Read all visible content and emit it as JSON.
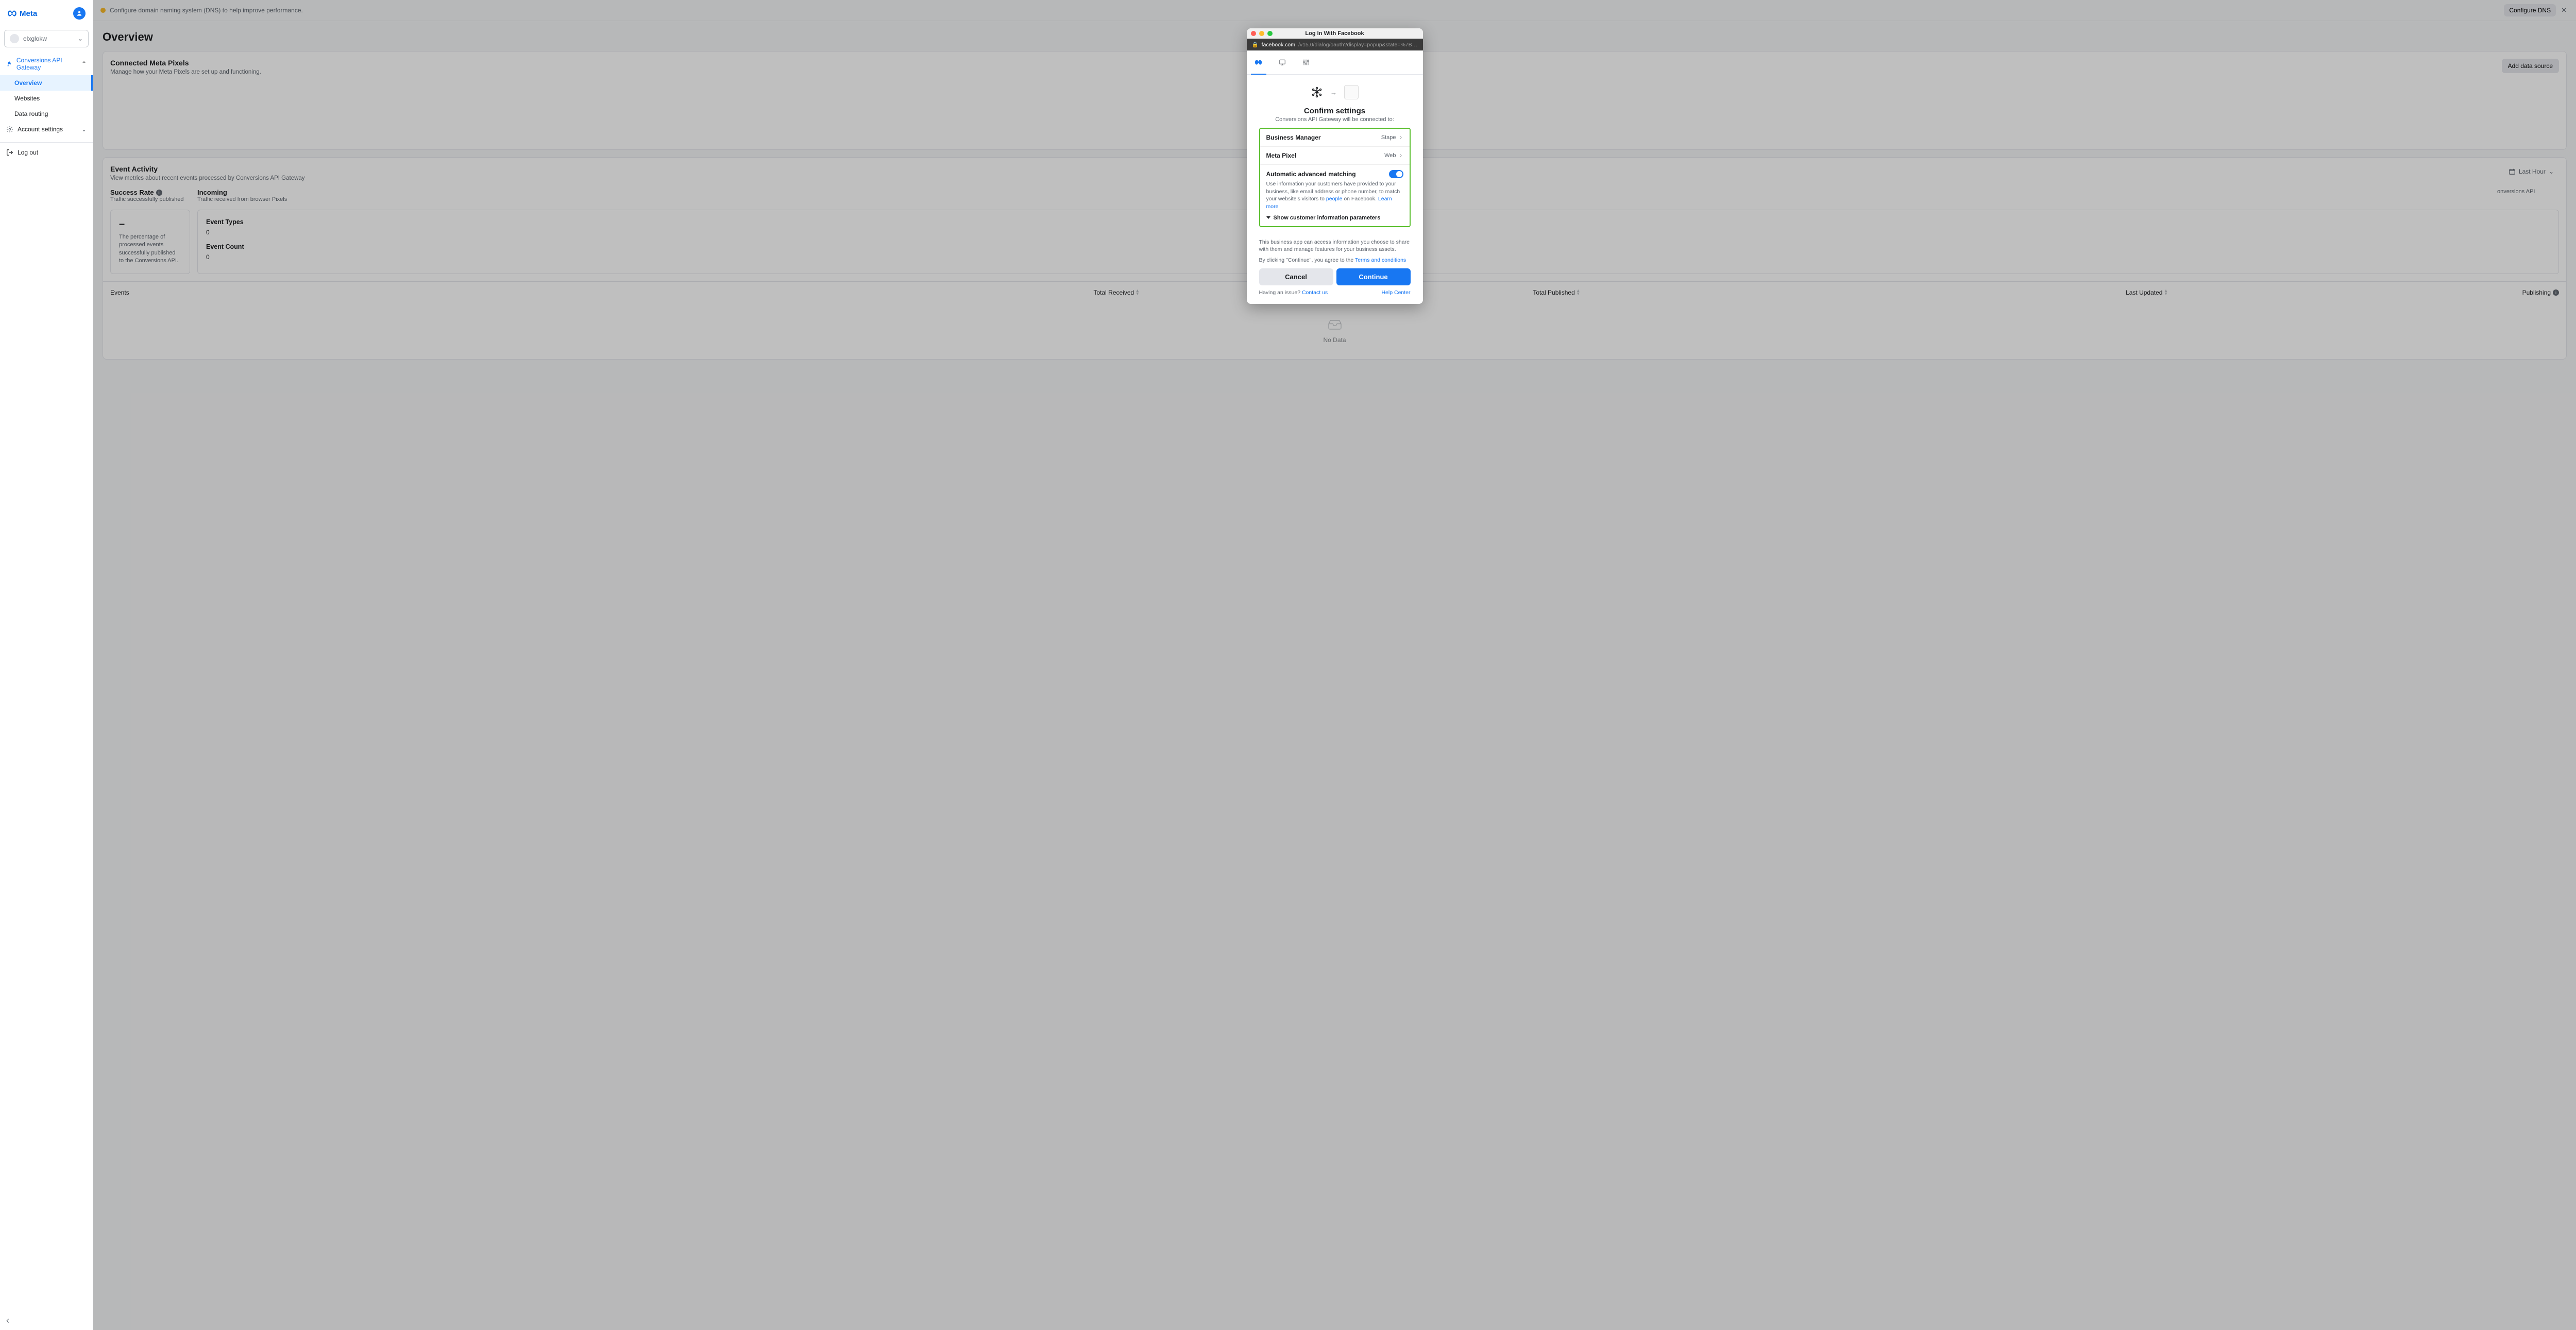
{
  "brand": "Meta",
  "workspace": {
    "name": "elxglokw"
  },
  "sidebar": {
    "group_label": "Conversions API Gateway",
    "items": [
      "Overview",
      "Websites",
      "Data routing"
    ],
    "account_settings": "Account settings",
    "logout": "Log out"
  },
  "banner": {
    "text": "Configure domain naming system (DNS) to help improve performance.",
    "button": "Configure DNS",
    "close": "✕"
  },
  "page": {
    "title": "Overview"
  },
  "connected_pixels": {
    "title": "Connected Meta Pixels",
    "subtitle": "Manage how your Meta Pixels are set up and functioning.",
    "add_button": "Add data source"
  },
  "event_activity": {
    "title": "Event Activity",
    "subtitle": "View metrics about recent events processed by Conversions API Gateway",
    "time_label": "Last Hour",
    "success_rate": {
      "title": "Success Rate",
      "desc": "Traffic successfully published"
    },
    "incoming": {
      "title": "Incoming",
      "desc": "Traffic received from browser Pixels"
    },
    "outgoing_suffix": "onversions API",
    "box1": {
      "value": "–",
      "desc": "The percentage of processed events successfully published to the Conversions API."
    },
    "box2": {
      "event_types": "Event Types",
      "event_types_val": "0",
      "event_count": "Event Count",
      "event_count_val": "0"
    }
  },
  "table": {
    "cols": {
      "events": "Events",
      "received": "Total Received",
      "published": "Total Published",
      "updated": "Last Updated",
      "publishing": "Publishing"
    },
    "no_data": "No Data"
  },
  "popup": {
    "window_title": "Log In With Facebook",
    "url_domain": "facebook.com",
    "url_path": "/v15.0/dialog/oauth?display=popup&state=%7B\"uid\"%3A\"88f…",
    "confirm_title": "Confirm settings",
    "confirm_sub": "Conversions API Gateway will be connected to:",
    "rows": {
      "business_manager": {
        "label": "Business Manager",
        "value": "Stape"
      },
      "meta_pixel": {
        "label": "Meta Pixel",
        "value": "Web"
      }
    },
    "aam": {
      "title": "Automatic advanced matching",
      "body_pre": "Use information your customers have provided to your business, like email address or phone number, to match your website's visitors to ",
      "body_link1": "people",
      "body_mid": " on Facebook. ",
      "learn_more": "Learn more",
      "show_params": "Show customer information parameters"
    },
    "disclaimer1": "This business app can access information you choose to share with them and manage features for your business assets.",
    "disclaimer2_pre": "By clicking \"Continue\", you agree to the ",
    "terms": "Terms and conditions",
    "cancel": "Cancel",
    "continue": "Continue",
    "issue_pre": "Having an issue? ",
    "contact": "Contact us",
    "help_center": "Help Center"
  }
}
